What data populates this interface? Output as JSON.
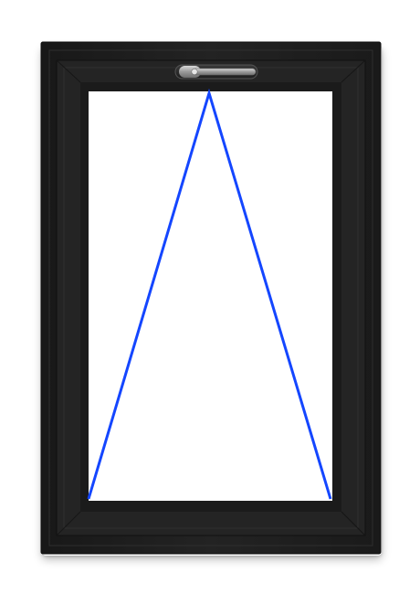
{
  "window": {
    "type": "top-hung window",
    "frame_color": "#1e1e1e",
    "sash_color": "#262626",
    "glass_color": "#ffffff",
    "opening_indicator_color": "#1446ff",
    "handle_color": "#a6a6a6",
    "opening_indicator": "triangle-apex-top",
    "handle_icon": "window-handle-icon"
  }
}
